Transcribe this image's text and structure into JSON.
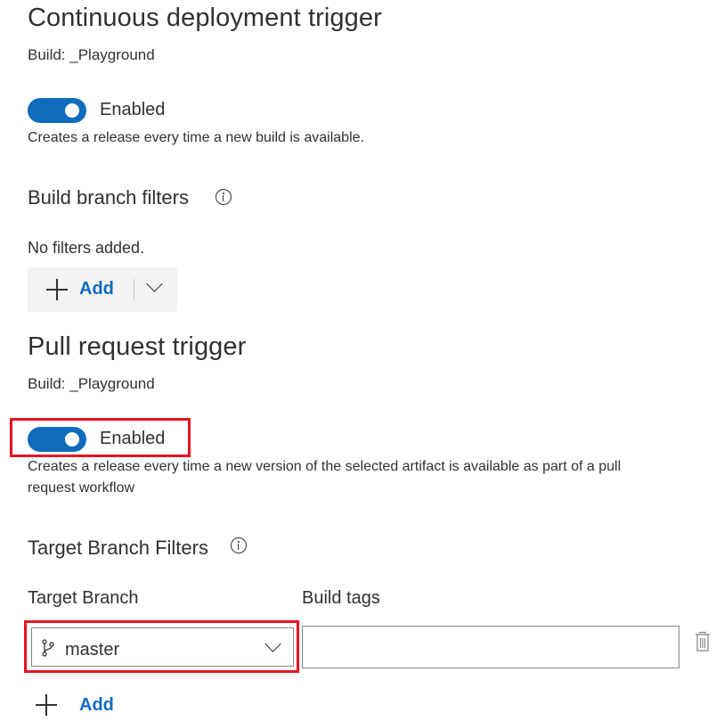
{
  "cd_trigger": {
    "title": "Continuous deployment trigger",
    "build": "Build: _Playground",
    "toggle_label": "Enabled",
    "description": "Creates a release every time a new build is available.",
    "filters_title": "Build branch filters",
    "no_filters": "No filters added.",
    "add_label": "Add"
  },
  "pr_trigger": {
    "title": "Pull request trigger",
    "build": "Build: _Playground",
    "toggle_label": "Enabled",
    "description_line1": "Creates a release every time a new version of the selected artifact is available as part of a pull",
    "description_line2": "request workflow",
    "filters_title": "Target Branch Filters",
    "target_branch_label": "Target Branch",
    "build_tags_label": "Build tags",
    "target_branch_value": "master",
    "build_tags_value": "",
    "add_label": "Add"
  },
  "colors": {
    "accent": "#0f6cbd",
    "highlight": "#e81123"
  },
  "icons": {
    "info": "info-icon",
    "plus": "plus-icon",
    "chevron": "chevron-down-icon",
    "branch": "branch-icon",
    "delete": "trash-icon"
  }
}
